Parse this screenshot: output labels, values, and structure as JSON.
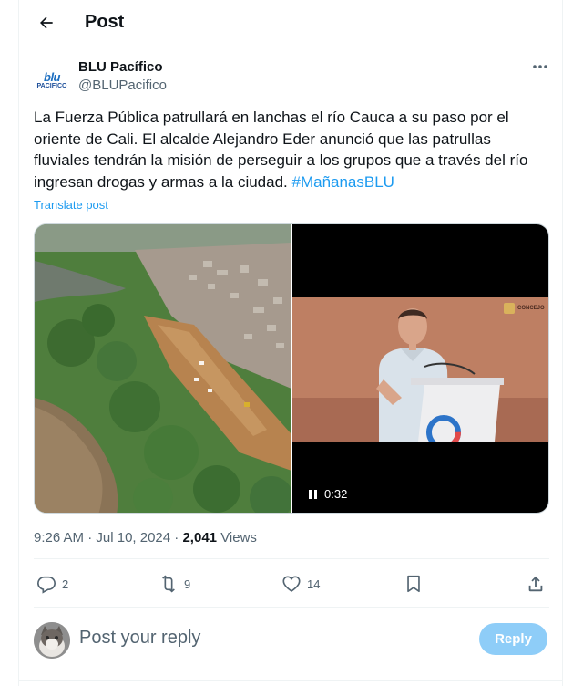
{
  "header": {
    "title": "Post"
  },
  "author": {
    "name": "BLU Pacífico",
    "handle": "@BLUPacifico",
    "logo_text_top": "blu",
    "logo_text_bottom": "PACIFICO"
  },
  "post": {
    "text": "La Fuerza Pública patrullará en lanchas el río Cauca a su paso por el oriente de Cali. El alcalde Alejandro Eder anunció que las patrullas fluviales tendrán la misión de perseguir a los grupos que a través del río ingresan drogas y armas a la ciudad.",
    "hashtag": "#MañanasBLU",
    "translate_label": "Translate post"
  },
  "media": {
    "video_duration": "0:32",
    "video_overlay_logo": "CONCEJO"
  },
  "meta": {
    "time": "9:26 AM",
    "separator": " · ",
    "date": "Jul 10, 2024",
    "views_count": "2,041",
    "views_label": "Views"
  },
  "actions": {
    "replies": "2",
    "reposts": "9",
    "likes": "14"
  },
  "reply": {
    "placeholder": "Post your reply",
    "button_label": "Reply"
  },
  "colors": {
    "accent": "#1d9bf0",
    "reply_button_disabled": "#8ecdf8",
    "secondary_text": "#536471"
  }
}
